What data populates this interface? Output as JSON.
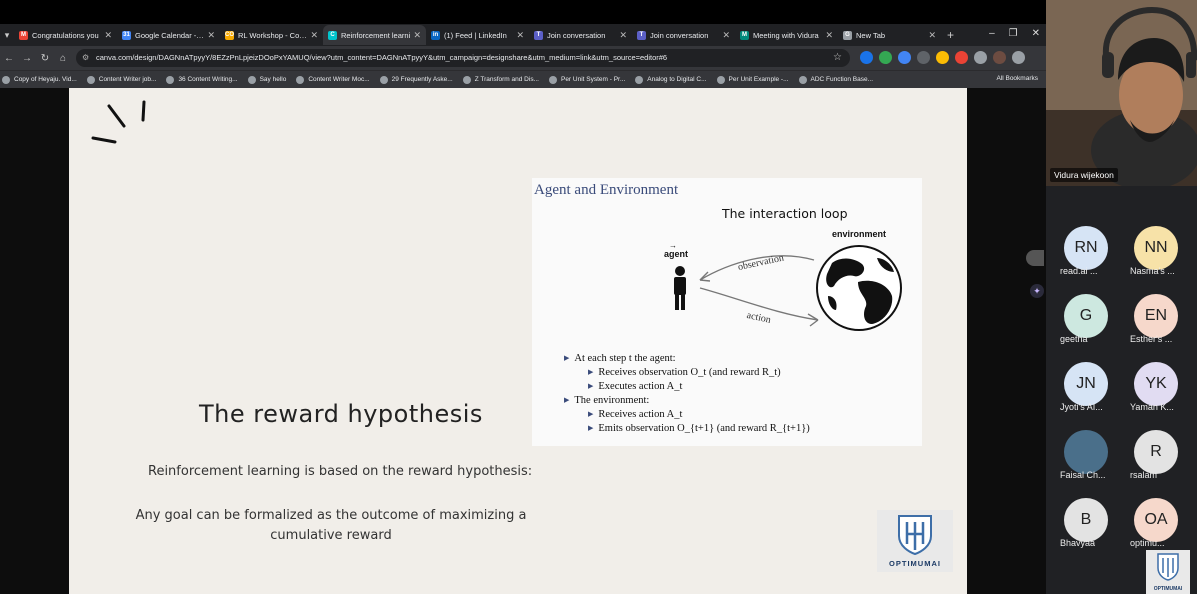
{
  "browser": {
    "tabs": [
      {
        "title": "Congratulations you",
        "favicon_color": "#ea4335",
        "favicon_text": "M"
      },
      {
        "title": "Google Calendar - W",
        "favicon_color": "#4285f4",
        "favicon_text": "31"
      },
      {
        "title": "RL Workshop - Colab",
        "favicon_color": "#f9ab00",
        "favicon_text": "CO"
      },
      {
        "title": "Reinforcement learni",
        "favicon_color": "#00c4cc",
        "favicon_text": "C",
        "active": true
      },
      {
        "title": "(1) Feed | LinkedIn",
        "favicon_color": "#0a66c2",
        "favicon_text": "in"
      },
      {
        "title": "Join conversation",
        "favicon_color": "#5b5fc7",
        "favicon_text": "T"
      },
      {
        "title": "Join conversation",
        "favicon_color": "#5b5fc7",
        "favicon_text": "T"
      },
      {
        "title": "Meeting with Vidura",
        "favicon_color": "#00897b",
        "favicon_text": "M"
      },
      {
        "title": "New Tab",
        "favicon_color": "#9aa0a6",
        "favicon_text": "G"
      }
    ],
    "url": "canva.com/design/DAGNnATpyyY/8EZzPnLpjeizDOoPxYAMUQ/view?utm_content=DAGNnATpyyY&utm_campaign=designshare&utm_medium=link&utm_source=editor#6",
    "bookmarks": [
      "Copy of Heyaju. Vid...",
      "Content Writer job...",
      "36 Content Writing...",
      "Say hello",
      "Content Writer Moc...",
      "29 Frequently Aske...",
      "Z Transform and Dis...",
      "Per Unit System - Pr...",
      "Analog to Digital C...",
      "Per Unit Example -...",
      "ADC Function Base..."
    ],
    "all_bookmarks": "All Bookmarks"
  },
  "slide": {
    "figure_heading": "Agent and Environment",
    "loop_title": "The interaction loop",
    "agent_label": "agent",
    "environment_label": "environment",
    "observation_label": "observation",
    "action_label": "action",
    "bullet_agent": "At each step t the agent:",
    "bullet_receives_obs": "Receives observation O_t (and reward R_t)",
    "bullet_executes": "Executes action A_t",
    "bullet_env": "The environment:",
    "bullet_receives_action": "Receives action A_t",
    "bullet_emits": "Emits observation O_{t+1} (and reward R_{t+1})",
    "title": "The reward hypothesis",
    "text1": "Reinforcement learning is based on the reward hypothesis:",
    "text2": "Any goal can be formalized as the outcome of maximizing a cumulative reward",
    "logo_text": "OPTIMUMAI"
  },
  "meeting": {
    "speaker_name": "Vidura wijekoon",
    "participants": [
      {
        "initials": "RN",
        "name": "read.ai ...",
        "color": "#d6e4f5"
      },
      {
        "initials": "NN",
        "name": "Nasma's ...",
        "color": "#f7e2a8"
      },
      {
        "initials": "G",
        "name": "geetha",
        "color": "#cde8e0"
      },
      {
        "initials": "EN",
        "name": "Esther's ...",
        "color": "#f6d8cb"
      },
      {
        "initials": "JN",
        "name": "Jyoti's AI...",
        "color": "#d6e4f5"
      },
      {
        "initials": "YK",
        "name": "Yaman K...",
        "color": "#e1dcf2"
      },
      {
        "initials": "",
        "name": "Faisal Ch...",
        "color": "#4a6f8a"
      },
      {
        "initials": "R",
        "name": "rsalam",
        "color": "#e3e3e3"
      },
      {
        "initials": "B",
        "name": "Bhavyaa",
        "color": "#e3e3e3"
      },
      {
        "initials": "OA",
        "name": "optimu...",
        "color": "#f6d8cb"
      }
    ],
    "mini_logo_text": "OPTIMUMAI"
  }
}
